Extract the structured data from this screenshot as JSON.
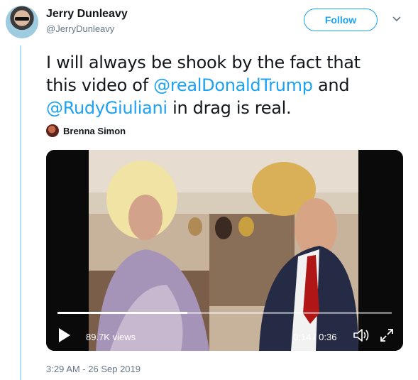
{
  "author": {
    "display_name": "Jerry Dunleavy",
    "handle": "@JerryDunleavy",
    "avatar_icon": "profile-avatar"
  },
  "follow_label": "Follow",
  "tweet": {
    "line1": "I will always be shook by the fact that",
    "line2_prefix": "this video of ",
    "mention1": "@realDonaldTrump",
    "line2_suffix": " and",
    "mention2": "@RudyGiuliani",
    "line3_suffix": " in drag is real."
  },
  "attribution": {
    "name": "Brenna Simon"
  },
  "video": {
    "views": "89.7K views",
    "time": "0:14 / 0:36",
    "progress_fraction": 0.389
  },
  "timestamp": "3:29 AM - 26 Sep 2019",
  "colors": {
    "accent": "#1da1f2",
    "thread_line": "#b1e2fb",
    "secondary_text": "#657786"
  }
}
